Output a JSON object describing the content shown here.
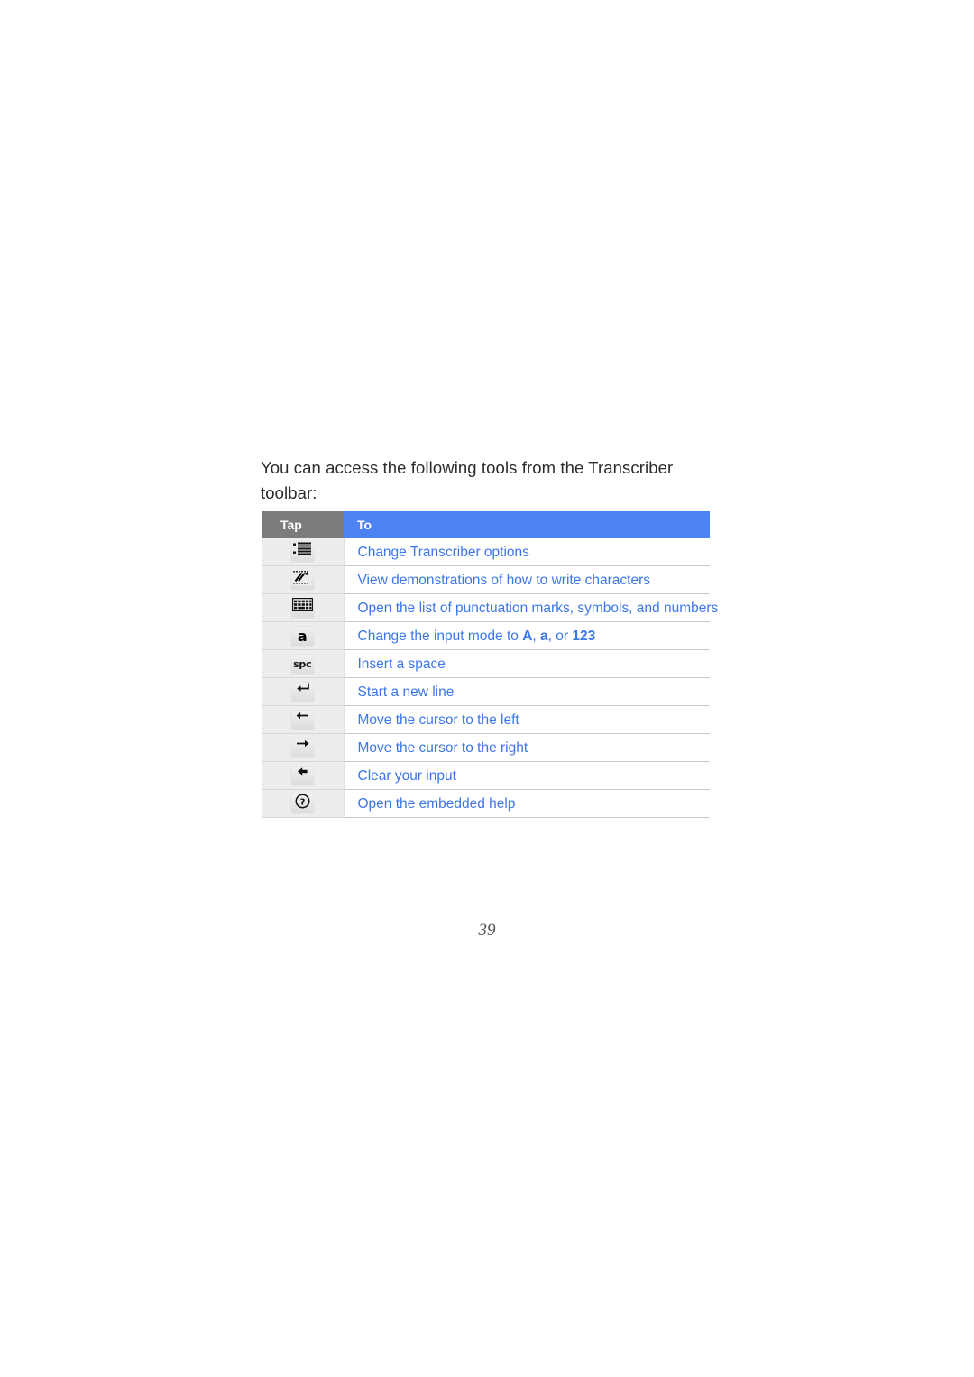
{
  "page": {
    "number": "39",
    "intro_text": "You can access the following tools from the Transcriber toolbar:"
  },
  "colors": {
    "header_tap_bg": "#7c7c7c",
    "header_to_bg": "#4d82f3",
    "link_text": "#3d76e8",
    "tap_cell_bg": "#ededed",
    "body_text": "#2b2b2b"
  },
  "table": {
    "headers": {
      "tap": "Tap",
      "to": "To"
    },
    "rows": [
      {
        "icon": "indented-list-icon",
        "text": "Change Transcriber options",
        "text_parts": [
          {
            "t": "Change Transcriber options",
            "b": false
          }
        ]
      },
      {
        "icon": "handwriting-demo-icon",
        "text": "View demonstrations of how to write characters",
        "text_parts": [
          {
            "t": "View demonstrations of how to write characters",
            "b": false
          }
        ]
      },
      {
        "icon": "keyboard-grid-icon",
        "text": "Open the list of punctuation marks, symbols, and numbers",
        "text_parts": [
          {
            "t": "Open the list of punctuation marks, symbols, and numbers",
            "b": false
          }
        ]
      },
      {
        "icon": "letter-a-icon",
        "text": "Change the input mode to A, a, or 123",
        "text_parts": [
          {
            "t": "Change the input mode to ",
            "b": false
          },
          {
            "t": "A",
            "b": true
          },
          {
            "t": ", ",
            "b": false
          },
          {
            "t": "a",
            "b": true
          },
          {
            "t": ", or ",
            "b": false
          },
          {
            "t": "123",
            "b": true
          }
        ]
      },
      {
        "icon": "space-key-icon",
        "text": "Insert a space",
        "text_parts": [
          {
            "t": "Insert a space",
            "b": false
          }
        ]
      },
      {
        "icon": "enter-return-icon",
        "text": "Start a new line",
        "text_parts": [
          {
            "t": "Start a new line",
            "b": false
          }
        ]
      },
      {
        "icon": "arrow-left-icon",
        "text": "Move the cursor to the left",
        "text_parts": [
          {
            "t": "Move the cursor to the left",
            "b": false
          }
        ]
      },
      {
        "icon": "arrow-right-icon",
        "text": "Move the cursor to the right",
        "text_parts": [
          {
            "t": "Move the cursor to the right",
            "b": false
          }
        ]
      },
      {
        "icon": "backspace-icon",
        "text": "Clear your input",
        "text_parts": [
          {
            "t": "Clear your input",
            "b": false
          }
        ]
      },
      {
        "icon": "help-question-icon",
        "text": "Open the embedded help",
        "text_parts": [
          {
            "t": "Open the embedded help",
            "b": false
          }
        ]
      }
    ]
  }
}
